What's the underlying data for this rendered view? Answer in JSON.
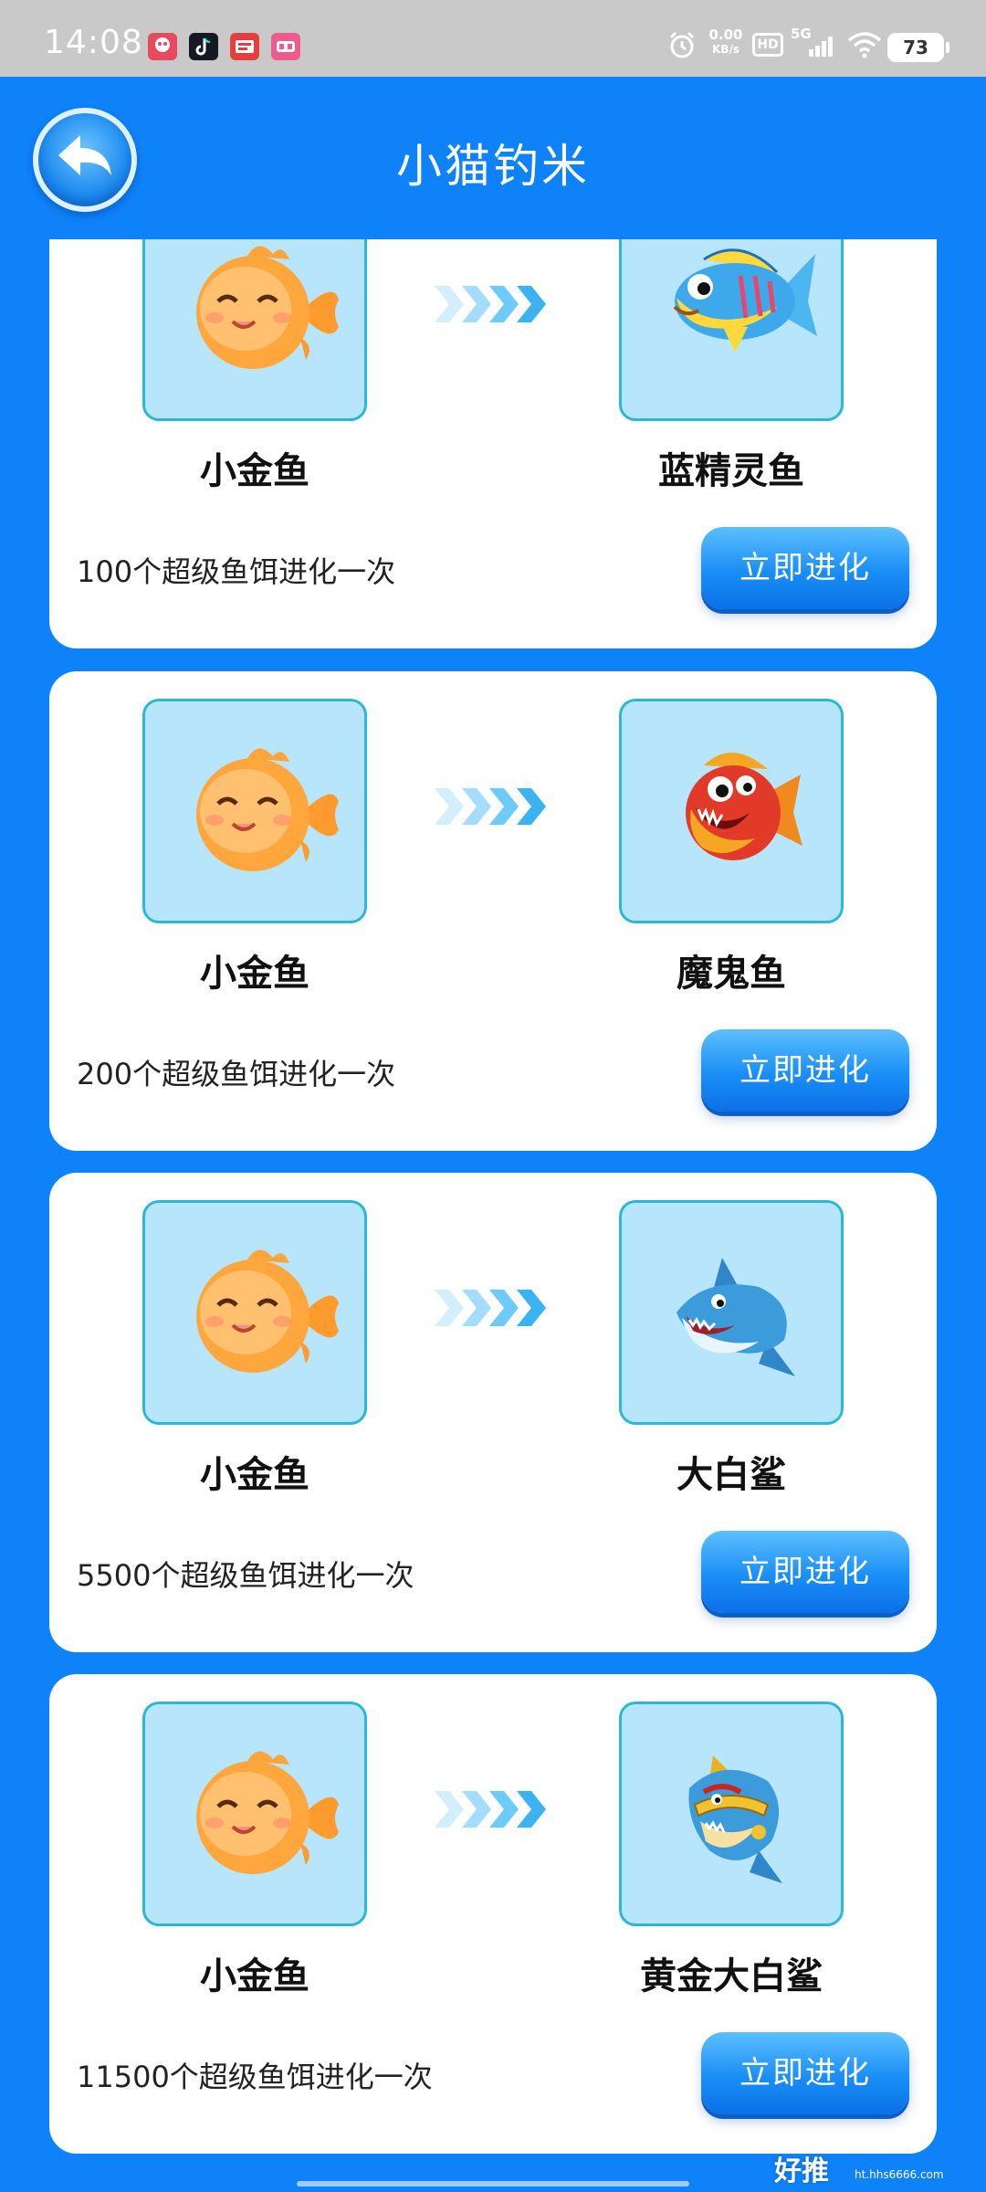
{
  "status_bar": {
    "time": "14:08",
    "net_speed_value": "0.00",
    "net_speed_unit": "KB/s",
    "hd": "HD",
    "network": "5G",
    "battery": "73",
    "app_icons": [
      {
        "name": "app-icon-1",
        "color": "#E64A5F"
      },
      {
        "name": "app-icon-2",
        "color": "#161823"
      },
      {
        "name": "app-icon-3",
        "color": "#E43F3F"
      },
      {
        "name": "app-icon-4",
        "color": "#EE5A8C"
      }
    ]
  },
  "header": {
    "title": "小猫钓米",
    "back_icon": "back-arrow-icon"
  },
  "cards": [
    {
      "from_fish": "小金鱼",
      "to_fish": "蓝精灵鱼",
      "cost": "100个超级鱼饵进化一次",
      "button": "立即进化"
    },
    {
      "from_fish": "小金鱼",
      "to_fish": "魔鬼鱼",
      "cost": "200个超级鱼饵进化一次",
      "button": "立即进化"
    },
    {
      "from_fish": "小金鱼",
      "to_fish": "大白鲨",
      "cost": "5500个超级鱼饵进化一次",
      "button": "立即进化"
    },
    {
      "from_fish": "小金鱼",
      "to_fish": "黄金大白鲨",
      "cost": "11500个超级鱼饵进化一次",
      "button": "立即进化"
    }
  ],
  "watermark": {
    "main": "好推",
    "sub": "ht.hhs6666.com"
  },
  "colors": {
    "background": "#0E82F8",
    "card": "#FFFFFF",
    "fish_box_bg": "#B7E6FC",
    "fish_box_border": "#2BB8D8",
    "button": "#1A8EF6"
  }
}
